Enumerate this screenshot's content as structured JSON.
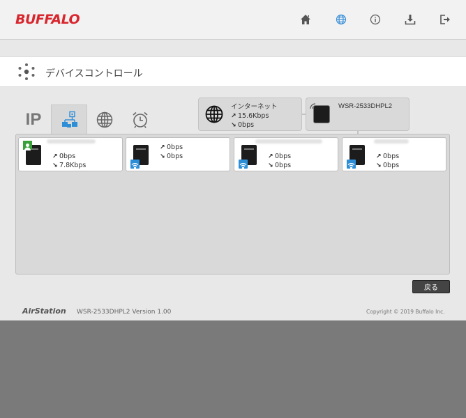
{
  "header": {
    "logo": "BUFFALO",
    "icons": [
      "home-icon",
      "globe-icon",
      "info-icon",
      "download-icon",
      "logout-icon"
    ]
  },
  "page": {
    "title": "デバイスコントロール"
  },
  "tabs": {
    "ip_label": "IP"
  },
  "internet": {
    "label": "インターネット",
    "up": "15.6Kbps",
    "down": "0bps"
  },
  "router": {
    "name": "WSR-2533DHPL2"
  },
  "devices": [
    {
      "up": "0bps",
      "down": "7.8Kbps",
      "badge": "user",
      "has_name": true
    },
    {
      "up": "0bps",
      "down": "0bps",
      "badge": "wifi",
      "has_name": false
    },
    {
      "up": "0bps",
      "down": "0bps",
      "badge": "wifi",
      "has_name": true
    },
    {
      "up": "0bps",
      "down": "0bps",
      "badge": "wifi",
      "has_name": true
    }
  ],
  "actions": {
    "back_label": "戻る"
  },
  "footer": {
    "brand": "AirStation",
    "model": "WSR-2533DHPL2   Version 1.00",
    "copyright": "Copyright © 2019 Buffalo Inc."
  },
  "colors": {
    "brand_red": "#d8262e",
    "accent_blue": "#2d8ed8",
    "user_green": "#3aa03a"
  }
}
